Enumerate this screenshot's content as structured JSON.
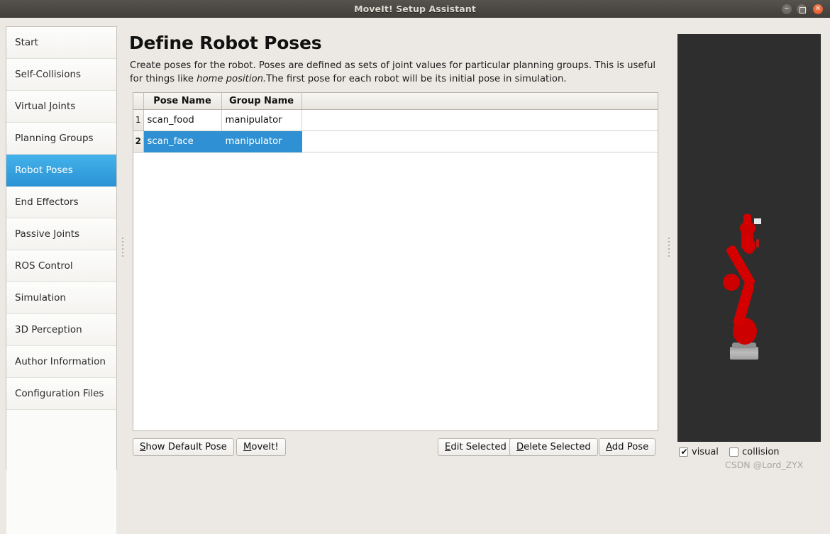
{
  "window": {
    "title": "MoveIt! Setup Assistant",
    "controls": {
      "minimize": "minimize-button",
      "maximize": "maximize-button",
      "close": "close-button",
      "close_glyph": "✕",
      "minimize_glyph": "–"
    }
  },
  "sidebar": {
    "items": [
      {
        "label": "Start",
        "selected": false
      },
      {
        "label": "Self-Collisions",
        "selected": false
      },
      {
        "label": "Virtual Joints",
        "selected": false
      },
      {
        "label": "Planning Groups",
        "selected": false
      },
      {
        "label": "Robot Poses",
        "selected": true
      },
      {
        "label": "End Effectors",
        "selected": false
      },
      {
        "label": "Passive Joints",
        "selected": false
      },
      {
        "label": "ROS Control",
        "selected": false
      },
      {
        "label": "Simulation",
        "selected": false
      },
      {
        "label": "3D Perception",
        "selected": false
      },
      {
        "label": "Author Information",
        "selected": false
      },
      {
        "label": "Configuration Files",
        "selected": false
      }
    ]
  },
  "main": {
    "title": "Define Robot Poses",
    "description_part1": "Create poses for the robot. Poses are defined as sets of joint values for particular planning groups. This is useful for things like ",
    "description_italic": "home position.",
    "description_part2": "The first pose for each robot will be its initial pose in simulation.",
    "table": {
      "headers": [
        "Pose Name",
        "Group Name"
      ],
      "rows": [
        {
          "number": "1",
          "pose_name": "scan_food",
          "group_name": "manipulator",
          "selected": false
        },
        {
          "number": "2",
          "pose_name": "scan_face",
          "group_name": "manipulator",
          "selected": true
        }
      ]
    },
    "buttons": {
      "show_default_pose": {
        "mnemonic": "S",
        "rest": "how Default Pose"
      },
      "moveit": {
        "mnemonic": "M",
        "rest": "oveIt!"
      },
      "edit_selected": {
        "mnemonic": "E",
        "rest": "dit Selected"
      },
      "delete_selected": {
        "mnemonic": "D",
        "rest": "elete Selected"
      },
      "add_pose": {
        "mnemonic": "A",
        "rest": "dd Pose"
      }
    }
  },
  "viewport": {
    "background_color": "#2e2e2e",
    "robot_color": "#d40000",
    "options": [
      {
        "label": "visual",
        "checked": true
      },
      {
        "label": "collision",
        "checked": false
      }
    ]
  },
  "watermark": "CSDN @Lord_ZYX",
  "colors": {
    "accent_blue": "#2f91d3",
    "sidebar_selected_top": "#43b2ea",
    "sidebar_selected_bottom": "#2c93d6",
    "window_bg": "#ece9e4",
    "titlebar": "#4b4843"
  }
}
